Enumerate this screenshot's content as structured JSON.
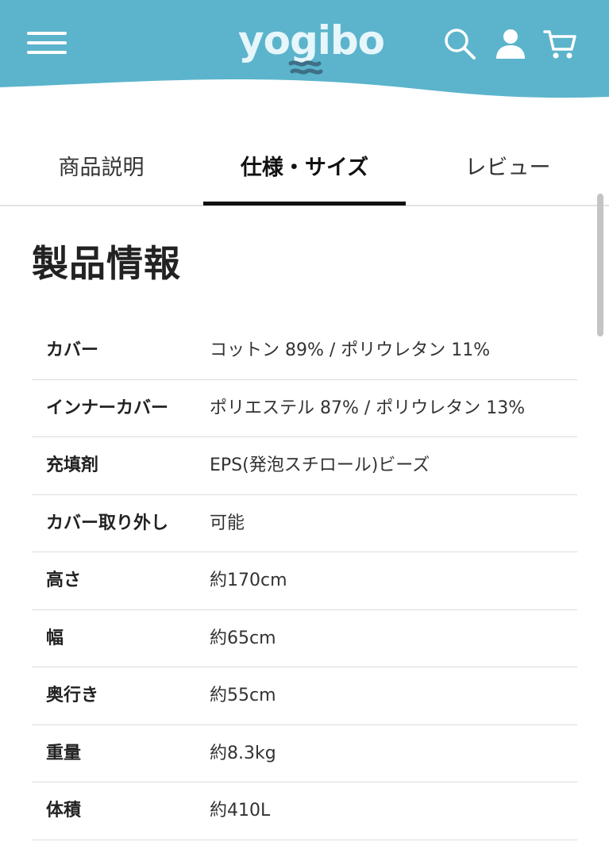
{
  "header": {
    "brand": "yogibo",
    "background_color": "#5BB4CB",
    "icons": [
      "hamburger-menu-icon",
      "search-icon",
      "user-icon",
      "cart-icon"
    ]
  },
  "tabs": [
    {
      "label": "商品説明",
      "active": false
    },
    {
      "label": "仕様・サイズ",
      "active": true
    },
    {
      "label": "レビュー",
      "active": false
    }
  ],
  "section": {
    "title": "製品情報"
  },
  "specs": [
    {
      "label": "カバー",
      "value": "コットン 89% / ポリウレタン 11%"
    },
    {
      "label": "インナーカバー",
      "value": "ポリエステル 87% / ポリウレタン 13%"
    },
    {
      "label": "充填剤",
      "value": "EPS(発泡スチロール)ビーズ"
    },
    {
      "label": "カバー取り外し",
      "value": "可能"
    },
    {
      "label": "高さ",
      "value": "約170cm"
    },
    {
      "label": "幅",
      "value": "約65cm"
    },
    {
      "label": "奥行き",
      "value": "約55cm"
    },
    {
      "label": "重量",
      "value": "約8.3kg"
    },
    {
      "label": "体積",
      "value": "約410L"
    }
  ]
}
